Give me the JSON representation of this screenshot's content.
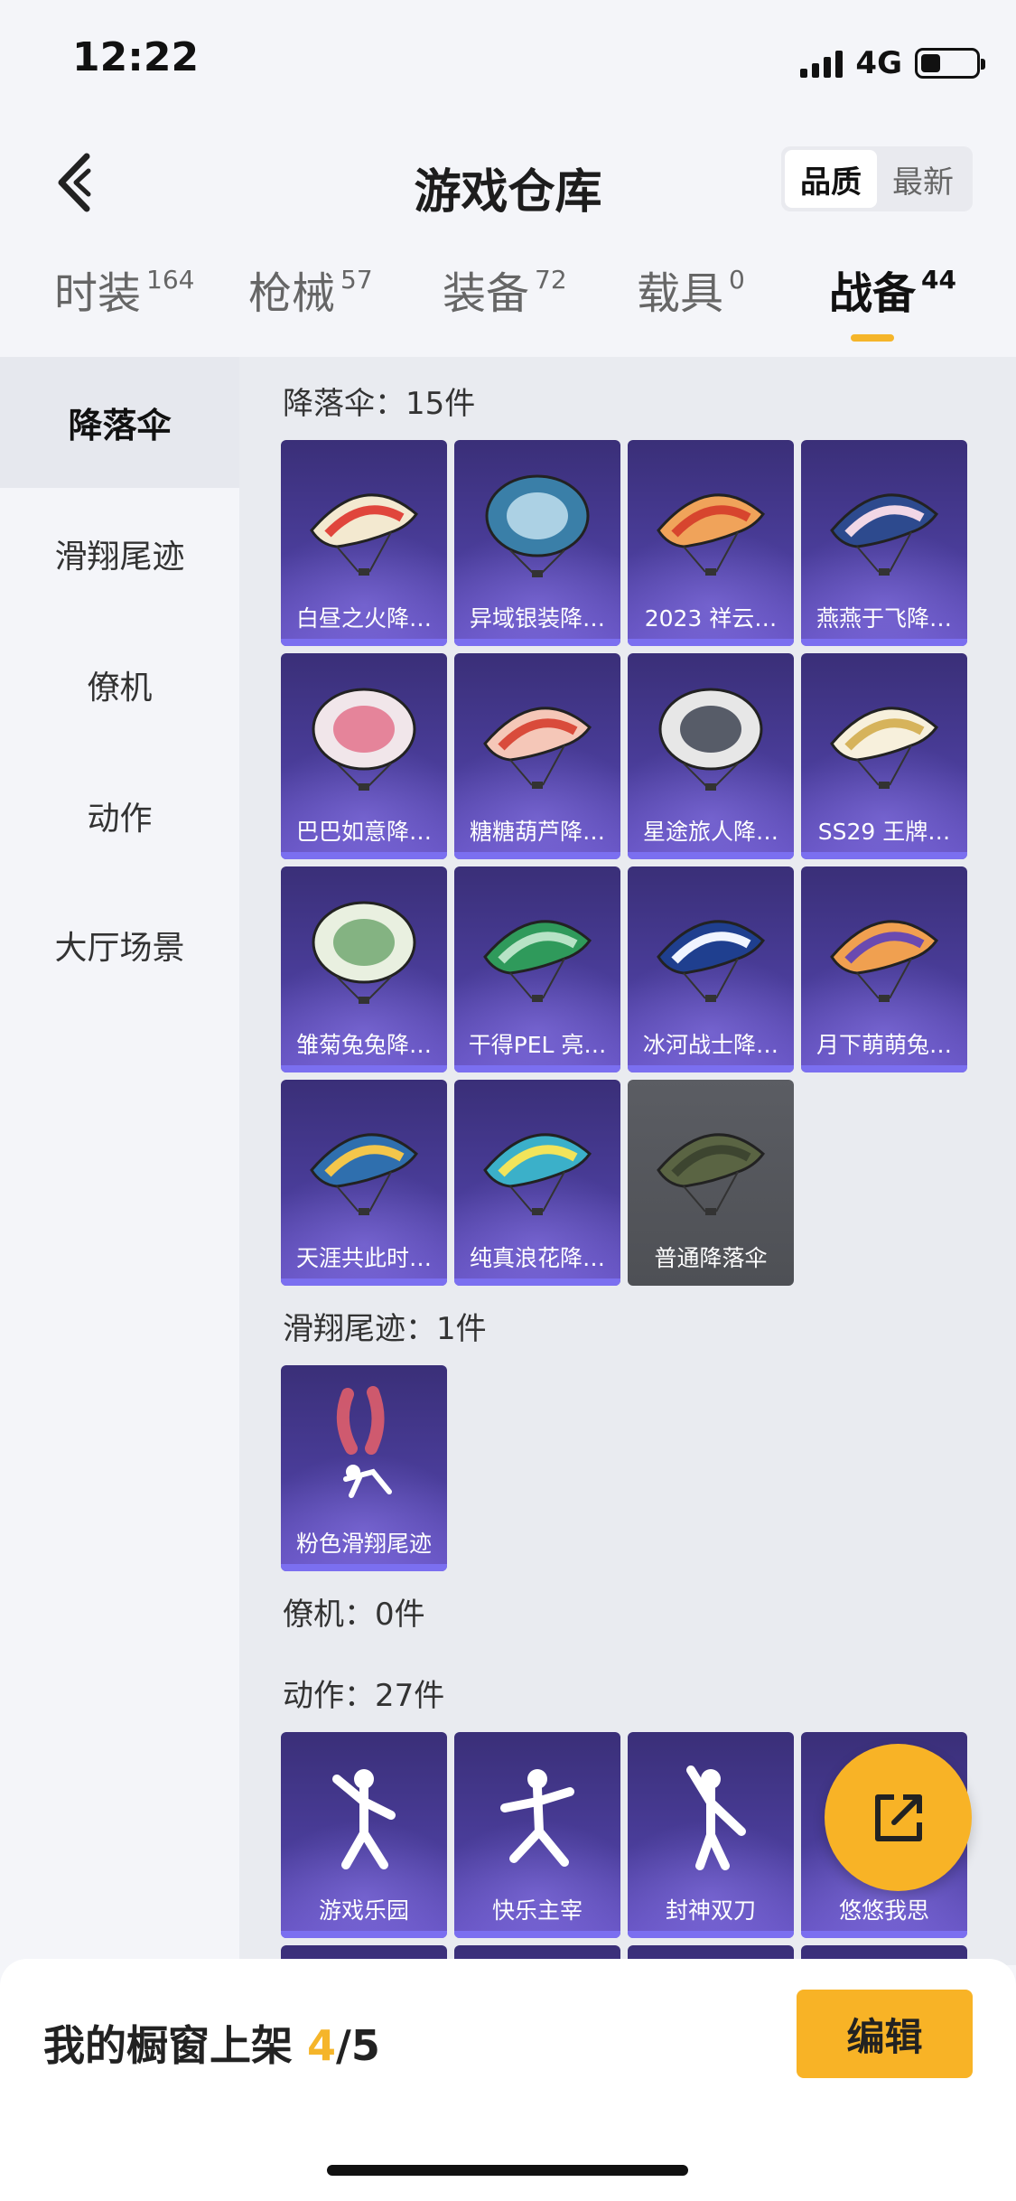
{
  "status": {
    "time": "12:22",
    "network": "4G",
    "battery_level": 0.36
  },
  "header": {
    "title": "游戏仓库",
    "sort": [
      "品质",
      "最新"
    ],
    "sort_active": 0
  },
  "tabs": [
    {
      "label": "时装",
      "count": "164"
    },
    {
      "label": "枪械",
      "count": "57"
    },
    {
      "label": "装备",
      "count": "72"
    },
    {
      "label": "载具",
      "count": "0"
    },
    {
      "label": "战备",
      "count": "44"
    }
  ],
  "active_tab": 4,
  "sidebar": [
    "降落伞",
    "滑翔尾迹",
    "僚机",
    "动作",
    "大厅场景"
  ],
  "sections": {
    "parachute": {
      "title": "降落伞：15件"
    },
    "trail": {
      "title": "滑翔尾迹：1件"
    },
    "wingman": {
      "title": "僚机：0件"
    },
    "emote": {
      "title": "动作：27件"
    }
  },
  "parachutes": [
    "白昼之火降…",
    "异域银装降…",
    "2023 祥云…",
    "燕燕于飞降…",
    "巴巴如意降…",
    "糖糖葫芦降…",
    "星途旅人降…",
    "SS29 王牌…",
    "雏菊兔兔降…",
    "干得PEL 亮…",
    "冰河战士降…",
    "月下萌萌兔…",
    "天涯共此时…",
    "纯真浪花降…",
    "普通降落伞"
  ],
  "trails": [
    "粉色滑翔尾迹"
  ],
  "emotes": [
    "游戏乐园",
    "快乐主宰",
    "封神双刀",
    "悠悠我思"
  ],
  "bottom": {
    "shelf_label": "我的橱窗上架 ",
    "shelf_count": "4",
    "shelf_total": "/5",
    "edit_label": "编辑"
  },
  "colors": {
    "accent": "#f8b326",
    "card_top": "#3a2f78",
    "card_bottom": "#6a57c8"
  }
}
